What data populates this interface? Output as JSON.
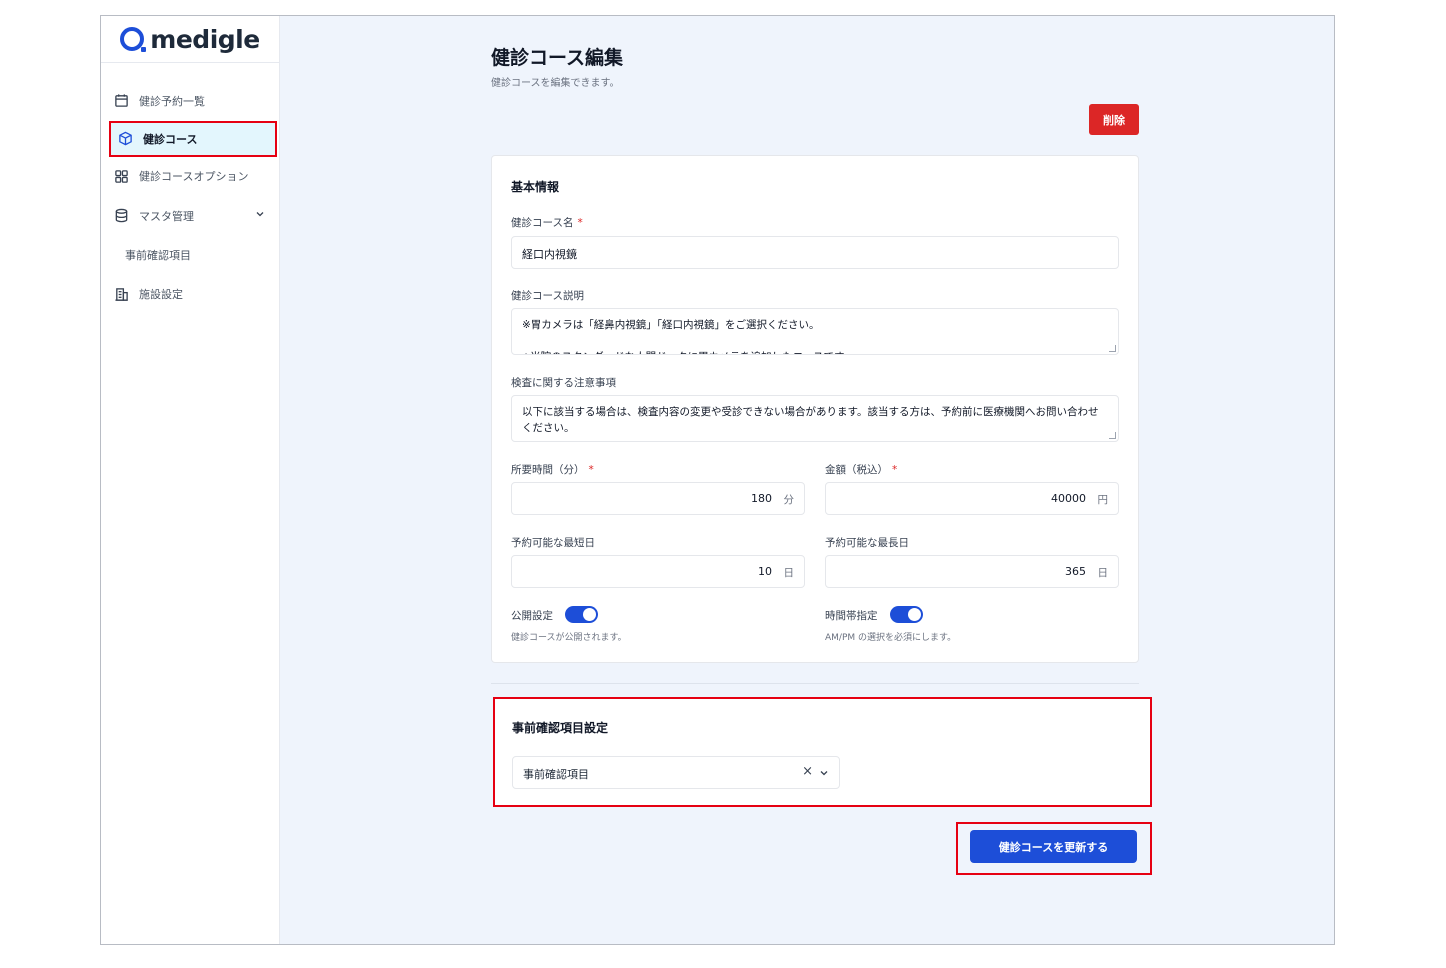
{
  "app": {
    "logo_text": "medigle"
  },
  "sidebar": {
    "items": [
      {
        "label": "健診予約一覧",
        "icon": "calendar-icon"
      },
      {
        "label": "健診コース",
        "icon": "cube-icon",
        "active": true
      },
      {
        "label": "健診コースオプション",
        "icon": "grid-icon"
      },
      {
        "label": "マスタ管理",
        "icon": "database-icon",
        "expanded": true
      },
      {
        "label": "事前確認項目",
        "sub": true
      },
      {
        "label": "施設設定",
        "icon": "building-icon"
      }
    ]
  },
  "page": {
    "title": "健診コース編集",
    "subtitle": "健診コースを編集できます。",
    "delete_label": "削除"
  },
  "basic": {
    "title": "基本情報",
    "course_name_label": "健診コース名",
    "course_name_value": "経口内視鏡",
    "description_label": "健診コース説明",
    "description_value": "※胃カメラは「経鼻内視鏡」「経口内視鏡」をご選択ください。\n\n◆当院のスタンダードな人間ドックに胃カメラを追加したコースです。",
    "notes_label": "検査に関する注意事項",
    "notes_value": "以下に該当する場合は、検査内容の変更や受診できない場合があります。該当する方は、予約前に医療機関へお問い合わせください。",
    "duration_label": "所要時間（分）",
    "duration_value": "180",
    "duration_unit": "分",
    "price_label": "金額（税込）",
    "price_value": "40000",
    "price_unit": "円",
    "min_days_label": "予約可能な最短日",
    "min_days_value": "10",
    "min_days_unit": "日",
    "max_days_label": "予約可能な最長日",
    "max_days_value": "365",
    "max_days_unit": "日",
    "publish_label": "公開設定",
    "publish_hint": "健診コースが公開されます。",
    "publish_on": true,
    "timeslot_label": "時間帯指定",
    "timeslot_hint": "AM/PM の選択を必須にします。",
    "timeslot_on": true,
    "required_mark": "*"
  },
  "precheck": {
    "title": "事前確認項目設定",
    "select_value": "事前確認項目"
  },
  "update_label": "健診コースを更新する",
  "colors": {
    "accent": "#1d4ed8",
    "danger": "#dc2626",
    "highlight": "#e60012"
  }
}
